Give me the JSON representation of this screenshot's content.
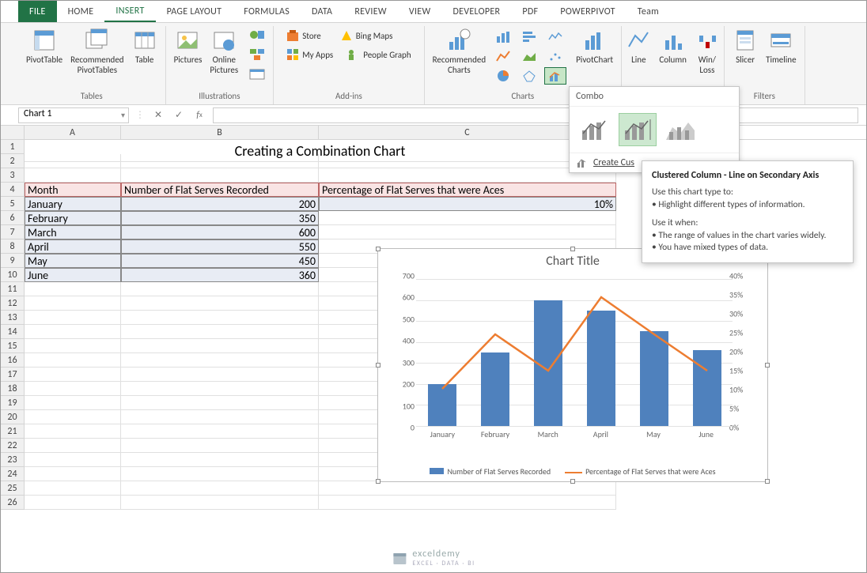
{
  "tabs": {
    "file": "FILE",
    "home": "HOME",
    "insert": "INSERT",
    "pagelayout": "PAGE LAYOUT",
    "formulas": "FORMULAS",
    "data": "DATA",
    "review": "REVIEW",
    "view": "VIEW",
    "developer": "DEVELOPER",
    "pdf": "PDF",
    "powerpivot": "POWERPIVOT",
    "team": "Team"
  },
  "ribbon": {
    "groups": {
      "tables": "Tables",
      "illustrations": "Illustrations",
      "addins": "Add-ins",
      "charts": "Charts",
      "filters": "Filters"
    },
    "btns": {
      "pivot": "PivotTable",
      "recpivot": "Recommended\nPivotTables",
      "table": "Table",
      "pictures": "Pictures",
      "online": "Online\nPictures",
      "store": "Store",
      "myapps": "My Apps",
      "bing": "Bing Maps",
      "people": "People Graph",
      "reccharts": "Recommended\nCharts",
      "pivotchart": "PivotChart",
      "line": "Line",
      "column": "Column",
      "winloss": "Win/\nLoss",
      "slicer": "Slicer",
      "timeline": "Timeline"
    }
  },
  "namebox": "Chart 1",
  "colhdrs": [
    "A",
    "B",
    "C"
  ],
  "rowhdrs": [
    "1",
    "2",
    "3",
    "4",
    "5",
    "6",
    "7",
    "8",
    "9",
    "10",
    "11",
    "12",
    "13",
    "14",
    "15",
    "16",
    "17",
    "18",
    "19",
    "20",
    "21",
    "22",
    "23",
    "24",
    "25",
    "26"
  ],
  "title": "Creating a Combination Chart",
  "table": {
    "headers": {
      "month": "Month",
      "serves": "Number of Flat Serves Recorded",
      "pct": "Percentage of Flat Serves that were Aces"
    },
    "rows": [
      {
        "month": "January",
        "serves": "200",
        "pct": "10%"
      },
      {
        "month": "February",
        "serves": "350",
        "pct": ""
      },
      {
        "month": "March",
        "serves": "600",
        "pct": ""
      },
      {
        "month": "April",
        "serves": "550",
        "pct": ""
      },
      {
        "month": "May",
        "serves": "450",
        "pct": ""
      },
      {
        "month": "June",
        "serves": "360",
        "pct": ""
      }
    ]
  },
  "combo_popup": {
    "hdr": "Combo",
    "foot": "Create Cus"
  },
  "tooltip": {
    "title": "Clustered Column - Line on Secondary Axis",
    "l1": "Use this chart type to:",
    "l2": "• Highlight different types of information.",
    "l3": "Use it when:",
    "l4": "• The range of values in the chart varies widely.",
    "l5": "• You have mixed types of data."
  },
  "chart_data": {
    "type": "combo",
    "title": "Chart Title",
    "categories": [
      "January",
      "February",
      "March",
      "April",
      "May",
      "June"
    ],
    "series": [
      {
        "name": "Number of Flat Serves Recorded",
        "type": "bar",
        "axis": "primary",
        "values": [
          200,
          350,
          600,
          550,
          450,
          360
        ]
      },
      {
        "name": "Percentage of Flat Serves that were Aces",
        "type": "line",
        "axis": "secondary",
        "values": [
          10,
          25,
          15,
          35,
          25,
          15
        ]
      }
    ],
    "ylim_primary": [
      0,
      700
    ],
    "yticks_primary": [
      0,
      100,
      200,
      300,
      400,
      500,
      600,
      700
    ],
    "ylim_secondary": [
      0,
      40
    ],
    "yticks_secondary": [
      "0%",
      "5%",
      "10%",
      "15%",
      "20%",
      "25%",
      "30%",
      "35%",
      "40%"
    ]
  },
  "watermark": {
    "main": "exceldemy",
    "sub": "EXCEL · DATA · BI"
  }
}
